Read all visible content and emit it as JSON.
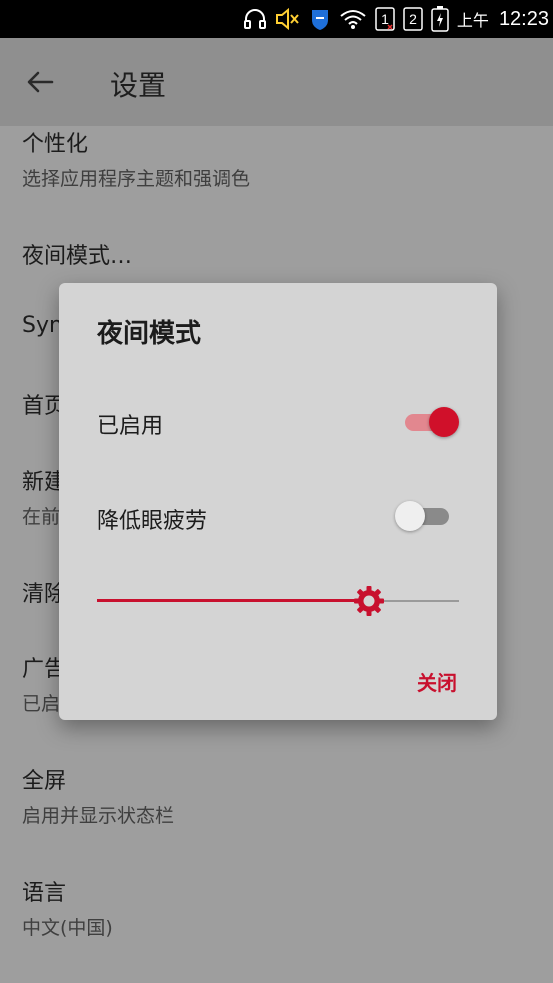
{
  "status_bar": {
    "ampm": "上午",
    "time": "12:23",
    "sim1": "1",
    "sim2": "2"
  },
  "app_bar": {
    "title": "设置"
  },
  "settings": [
    {
      "title": "个性化",
      "subtitle": "选择应用程序主题和强调色"
    },
    {
      "title": "夜间模式…",
      "subtitle": ""
    },
    {
      "title": "Syn",
      "subtitle": ""
    },
    {
      "title": "首页",
      "subtitle": ""
    },
    {
      "title": "新建",
      "subtitle": "在前"
    },
    {
      "title": "清除",
      "subtitle": ""
    },
    {
      "title": "广告",
      "subtitle": "已启"
    },
    {
      "title": "全屏",
      "subtitle": "启用并显示状态栏"
    },
    {
      "title": "语言",
      "subtitle": "中文(中国)"
    }
  ],
  "dialog": {
    "title": "夜间模式",
    "enabled_label": "已启用",
    "enabled_on": true,
    "eye_strain_label": "降低眼疲劳",
    "eye_strain_on": false,
    "slider_level": 0.75,
    "close_label": "关闭"
  },
  "colors": {
    "accent": "#c8102e",
    "switch_track_on": "#e2878f",
    "dialog_bg": "#d4d4d4",
    "scrim_bg": "#9e9e9e"
  }
}
